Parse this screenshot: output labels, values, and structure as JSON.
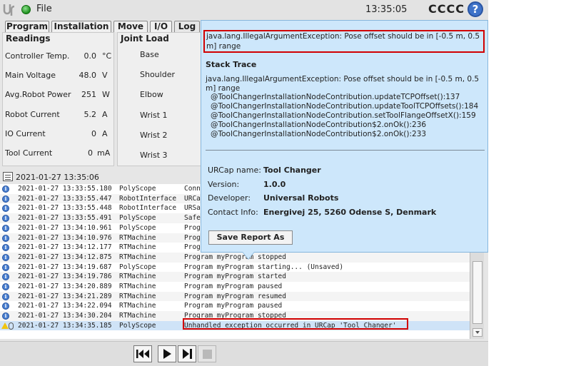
{
  "header": {
    "file_menu": "File",
    "clock": "13:35:05",
    "robot_name": "CCCC",
    "help": "?"
  },
  "tabs": [
    {
      "label": "Program"
    },
    {
      "label": "Installation"
    },
    {
      "label": "Move"
    },
    {
      "label": "I/O"
    },
    {
      "label": "Log"
    }
  ],
  "readings": {
    "title": "Readings",
    "rows": [
      {
        "label": "Controller Temp.",
        "value": "0.0",
        "unit": "°C"
      },
      {
        "label": "Main Voltage",
        "value": "48.0",
        "unit": "V"
      },
      {
        "label": "Avg.Robot Power",
        "value": "251",
        "unit": "W"
      },
      {
        "label": "Robot Current",
        "value": "5.2",
        "unit": "A"
      },
      {
        "label": "IO Current",
        "value": "0",
        "unit": "A"
      },
      {
        "label": "Tool Current",
        "value": "0",
        "unit": "mA"
      }
    ]
  },
  "joint_load": {
    "title": "Joint Load",
    "joints": [
      "Base",
      "Shoulder",
      "Elbow",
      "Wrist 1",
      "Wrist 2",
      "Wrist 3"
    ]
  },
  "log_timestamp": "2021-01-27 13:35:06",
  "log": [
    {
      "time": "2021-01-27 13:33:55.180",
      "source": "PolyScope",
      "message": "Conn"
    },
    {
      "time": "2021-01-27 13:33:55.447",
      "source": "RobotInterface",
      "message": "URCa"
    },
    {
      "time": "2021-01-27 13:33:55.448",
      "source": "RobotInterface",
      "message": "URSa"
    },
    {
      "time": "2021-01-27 13:33:55.491",
      "source": "PolyScope",
      "message": "Safe"
    },
    {
      "time": "2021-01-27 13:34:10.961",
      "source": "PolyScope",
      "message": "Prog"
    },
    {
      "time": "2021-01-27 13:34:10.976",
      "source": "RTMachine",
      "message": "Prog"
    },
    {
      "time": "2021-01-27 13:34:12.177",
      "source": "RTMachine",
      "message": "Prog"
    },
    {
      "time": "2021-01-27 13:34:12.875",
      "source": "RTMachine",
      "message": "Program myProgram stopped"
    },
    {
      "time": "2021-01-27 13:34:19.687",
      "source": "PolyScope",
      "message": "Program myProgram starting... (Unsaved)"
    },
    {
      "time": "2021-01-27 13:34:19.786",
      "source": "RTMachine",
      "message": "Program myProgram started"
    },
    {
      "time": "2021-01-27 13:34:20.889",
      "source": "RTMachine",
      "message": "Program myProgram paused"
    },
    {
      "time": "2021-01-27 13:34:21.289",
      "source": "RTMachine",
      "message": "Program myProgram resumed"
    },
    {
      "time": "2021-01-27 13:34:22.094",
      "source": "RTMachine",
      "message": "Program myProgram paused"
    },
    {
      "time": "2021-01-27 13:34:30.204",
      "source": "RTMachine",
      "message": "Program myProgram stopped"
    },
    {
      "time": "2021-01-27 13:34:35.185",
      "source": "PolyScope",
      "message": "Unhandled exception occurred in URCap 'Tool Changer'"
    }
  ],
  "popup": {
    "headline": "java.lang.IllegalArgumentException: Pose offset should be in [-0.5 m, 0.5 m] range",
    "stack_trace_title": "Stack Trace",
    "stack_trace_message": "java.lang.IllegalArgumentException: Pose offset should be in [-0.5 m, 0.5 m] range",
    "stack_trace_lines": [
      "@ToolChangerInstallationNodeContribution.updateTCPOffset():137",
      "@ToolChangerInstallationNodeContribution.updateToolTCPOffsets():184",
      "@ToolChangerInstallationNodeContribution.setToolFlangeOffsetX():159",
      "@ToolChangerInstallationNodeContribution$2.onOk():236",
      "@ToolChangerInstallationNodeContribution$2.onOk():233"
    ],
    "meta": [
      {
        "label": "URCap name:",
        "value": "Tool Changer"
      },
      {
        "label": "Version:",
        "value": "1.0.0"
      },
      {
        "label": "Developer:",
        "value": "Universal Robots"
      },
      {
        "label": "Contact Info:",
        "value": "Energivej 25, 5260 Odense S, Denmark"
      }
    ],
    "save_button": "Save Report As"
  },
  "colors": {
    "popup_bg": "#cde7fb",
    "highlight": "#d10000",
    "accent": "#3f73c9",
    "status_ok": "#1d8f1d"
  },
  "icons": [
    "ur-logo",
    "status-dot",
    "help-icon",
    "log-stamp-icon",
    "info-icon",
    "warning-icon",
    "attachment-icon",
    "rewind-icon",
    "play-icon",
    "step-icon",
    "stop-icon"
  ]
}
